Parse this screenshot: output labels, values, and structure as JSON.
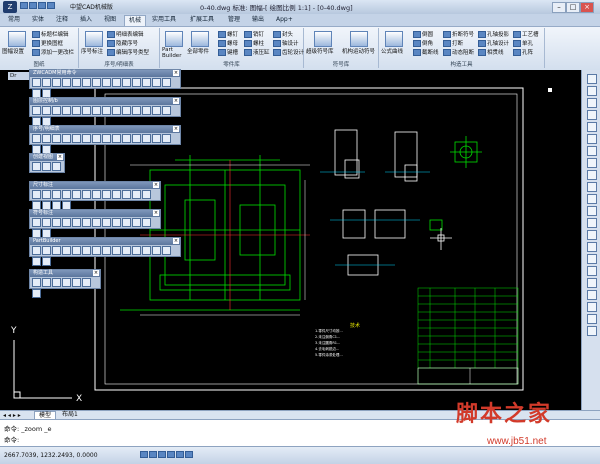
{
  "window": {
    "title": "0-40.dwg 标准: 图幅-[ 绘图比例 1:1] - [0-40.dwg]",
    "app_short": "中望CAD机械版"
  },
  "ribbon_tabs": [
    "常用",
    "实体",
    "注释",
    "插入",
    "视图",
    "机械",
    "实用工具",
    "扩展工具",
    "管理",
    "输出",
    "App+"
  ],
  "active_tab_index": 5,
  "ribbon": {
    "groups": [
      {
        "label": "图纸",
        "items": [
          "图幅设置",
          "标题栏编辑",
          "更换图框",
          "添加一更改栏"
        ]
      },
      {
        "label": "序号/明细表",
        "items": [
          "序号标注",
          "明细表编辑",
          "隐藏序号",
          "编辑序号类型"
        ]
      },
      {
        "label": "零件库",
        "items": [
          "Part Builder",
          "全部零件",
          "螺钉",
          "螺母",
          "键槽",
          "销钉",
          "螺柱",
          "液压缸",
          "封头",
          "轴设计",
          "齿轮设计"
        ]
      },
      {
        "label": "符号库",
        "items": [
          "超级符号库",
          "机构运动符号"
        ]
      },
      {
        "label": "构造工具",
        "items": [
          "公式曲线",
          "倒圆",
          "倒角",
          "截断线",
          "折断符号",
          "打断",
          "动态阻断",
          "孔轴投影",
          "孔轴设计",
          "相贯线",
          "工艺槽",
          "单孔",
          "孔阵"
        ]
      }
    ]
  },
  "toolbars": [
    {
      "title": "ZWCADM常用命令",
      "icons": 16
    },
    {
      "title": "图层控制/b",
      "icons": 16
    },
    {
      "title": "序号/明细表",
      "icons": 16
    },
    {
      "title": "创建视图",
      "icons": 3
    },
    {
      "title": "尺寸标注",
      "icons": 16
    },
    {
      "title": "符号标注",
      "icons": 14
    },
    {
      "title": "PartBuilder",
      "icons": 16
    },
    {
      "title": "构造工具",
      "icons": 7
    }
  ],
  "drawing": {
    "doc_tab": "Dr",
    "ucs_y": "Y",
    "ucs_x": "X",
    "note_title": "技术",
    "note_lines": [
      "1.零件尺寸均按...",
      "2.未注倒角C1...",
      "3.未注圆角R1...",
      "4.去毛刺锐边...",
      "5.零件涂漆处理..."
    ]
  },
  "layout_tabs": [
    "模型",
    "布局1"
  ],
  "command": {
    "history": "命令:  _zoom _e",
    "prompt": "命令:"
  },
  "status": {
    "coords": "2667.7039, 1232.2493, 0.0000"
  },
  "watermark": {
    "brand": "脚本之家",
    "url": "www.jb51.net"
  },
  "colors": {
    "drawing_bg": "#000000",
    "line_green": "#00e000",
    "line_white": "#ffffff",
    "line_cyan": "#00d8ff",
    "line_red": "#ff3030",
    "line_yellow": "#e8e800"
  }
}
